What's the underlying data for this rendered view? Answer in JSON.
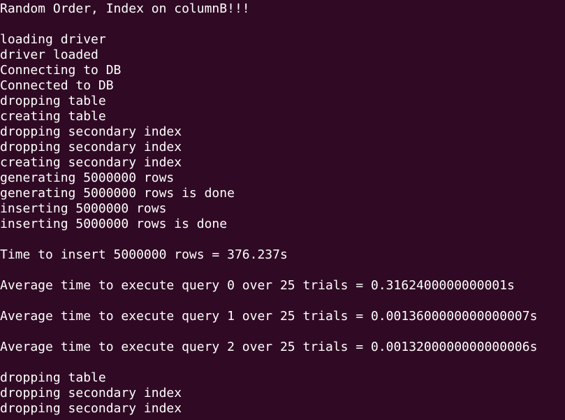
{
  "terminal": {
    "background_color": "#300a24",
    "text_color": "#ffffff",
    "lines": [
      "Random Order, Index on columnB!!!",
      "",
      "loading driver",
      "driver loaded",
      "Connecting to DB",
      "Connected to DB",
      "dropping table",
      "creating table",
      "dropping secondary index",
      "dropping secondary index",
      "creating secondary index",
      "generating 5000000 rows",
      "generating 5000000 rows is done",
      "inserting 5000000 rows",
      "inserting 5000000 rows is done",
      "",
      "Time to insert 5000000 rows = 376.237s",
      "",
      "Average time to execute query 0 over 25 trials = 0.3162400000000001s",
      "",
      "Average time to execute query 1 over 25 trials = 0.0013600000000000007s",
      "",
      "Average time to execute query 2 over 25 trials = 0.0013200000000000006s",
      "",
      "dropping table",
      "dropping secondary index",
      "dropping secondary index"
    ]
  }
}
